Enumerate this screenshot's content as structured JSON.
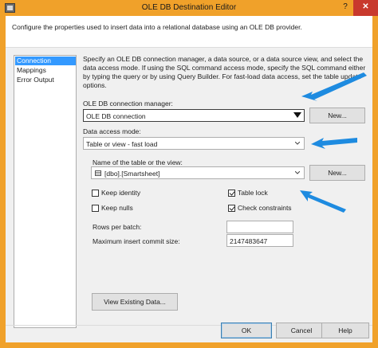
{
  "window": {
    "title": "OLE DB Destination Editor",
    "help_glyph": "?",
    "close_glyph": "✕"
  },
  "header": {
    "text": "Configure the properties used to insert data into a relational database using an OLE DB provider."
  },
  "nav": {
    "items": [
      {
        "label": "Connection Manager",
        "selected": true
      },
      {
        "label": "Mappings",
        "selected": false
      },
      {
        "label": "Error Output",
        "selected": false
      }
    ]
  },
  "main": {
    "description": "Specify an OLE DB connection manager, a data source, or a data source view, and select the data access mode. If using the SQL command access mode, specify the SQL command either by typing the query or by using Query Builder. For fast-load data access, set the table update options.",
    "connection_manager_label": "OLE DB connection manager:",
    "connection_manager_value": "OLE DB connection",
    "new_connection_label": "New...",
    "access_mode_label": "Data access mode:",
    "access_mode_value": "Table or view - fast load",
    "table_name_label": "Name of the table or the view:",
    "table_name_value": "[dbo].[Smartsheet]",
    "new_table_label": "New...",
    "keep_identity": {
      "label": "Keep identity",
      "checked": false
    },
    "table_lock": {
      "label": "Table lock",
      "checked": true
    },
    "keep_nulls": {
      "label": "Keep nulls",
      "checked": false
    },
    "check_constraints": {
      "label": "Check constraints",
      "checked": true
    },
    "rows_per_batch_label": "Rows per batch:",
    "rows_per_batch_value": "",
    "max_commit_label": "Maximum insert commit size:",
    "max_commit_value": "2147483647",
    "view_existing_label": "View Existing Data..."
  },
  "footer": {
    "ok_label": "OK",
    "cancel_label": "Cancel",
    "help_label": "Help"
  },
  "colors": {
    "title_bar": "#f0a12a",
    "close_button": "#c8392d",
    "selection": "#3399ff",
    "annotation_arrow": "#1e8be0"
  }
}
